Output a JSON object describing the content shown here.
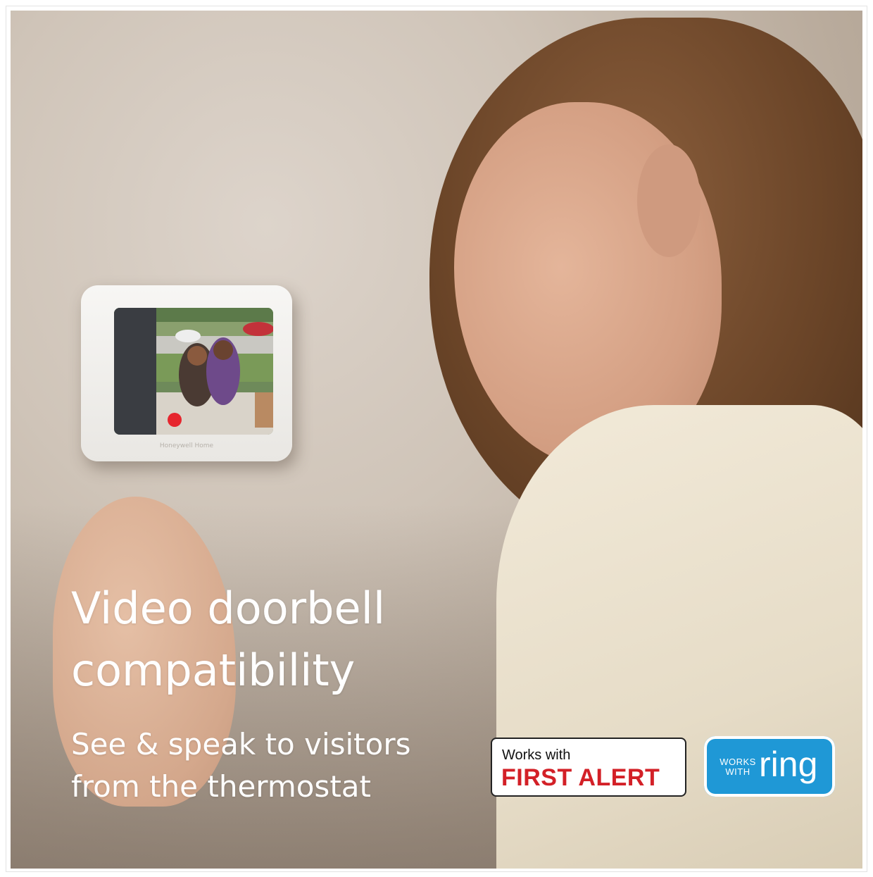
{
  "headline": {
    "line1": "Video doorbell",
    "line2": "compatibility"
  },
  "subheadline": {
    "line1": "See & speak to visitors",
    "line2": "from the thermostat"
  },
  "device": {
    "brand": "Honeywell Home"
  },
  "badges": {
    "first_alert": {
      "prefix": "Works with",
      "name": "FIRST ALERT"
    },
    "ring": {
      "line1": "WORKS",
      "line2": "WITH",
      "word": "ring"
    }
  },
  "colors": {
    "headline_text": "#ffffff",
    "first_alert_red": "#d32027",
    "ring_blue": "#1f98d6",
    "call_red": "#e6262e"
  }
}
